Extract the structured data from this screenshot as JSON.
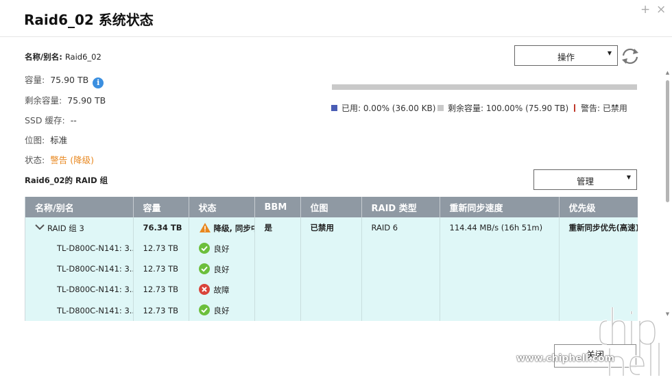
{
  "window": {
    "title": "Raid6_02  系统状态",
    "add_icon": "plus-icon",
    "close_icon": "close-icon"
  },
  "info": {
    "name_label": "名称/别名:",
    "name_value": "Raid6_02",
    "capacity_label": "容量:",
    "capacity_value": "75.90 TB",
    "free_label": "剩余容量:",
    "free_value": "75.90 TB",
    "ssd_cache_label": "SSD 缓存:",
    "ssd_cache_value": "--",
    "bitmap_label": "位图:",
    "bitmap_value": "标准",
    "status_label": "状态:",
    "status_value": "警告 (降级)"
  },
  "actions": {
    "operation_label": "操作",
    "manage_label": "管理"
  },
  "usage": {
    "used_fraction": 0.0,
    "legend_used": "已用: 0.00% (36.00 KB)",
    "legend_free": "剩余容量: 100.00% (75.90 TB)",
    "legend_warning": "警告: 已禁用",
    "color_used": "#4a5db5",
    "color_free": "#c9c9c9",
    "color_warning": "#c0392b"
  },
  "raid_group_title": "Raid6_02的 RAID 组",
  "table": {
    "headers": [
      "名称/别名",
      "容量",
      "状态",
      "BBM",
      "位图",
      "RAID 类型",
      "重新同步速度",
      "优先级"
    ],
    "group": {
      "name": "RAID 组 3",
      "capacity": "76.34 TB",
      "status": "降级, 同步中",
      "bbm": "是",
      "bitmap": "已禁用",
      "raid_type": "RAID 6",
      "resync_speed": "114.44 MB/s (16h 51m)",
      "priority": "重新同步优先(高速)"
    },
    "disks": [
      {
        "name": "TL-D800C-N141: 3...",
        "capacity": "12.73 TB",
        "status": "良好",
        "status_icon": "check-icon"
      },
      {
        "name": "TL-D800C-N141: 3...",
        "capacity": "12.73 TB",
        "status": "良好",
        "status_icon": "check-icon"
      },
      {
        "name": "TL-D800C-N141: 3...",
        "capacity": "12.73 TB",
        "status": "故障",
        "status_icon": "error-icon"
      },
      {
        "name": "TL-D800C-N141: 3...",
        "capacity": "12.73 TB",
        "status": "良好",
        "status_icon": "check-icon"
      }
    ]
  },
  "footer": {
    "close_label": "关闭"
  },
  "watermark": {
    "text": "www.chiphell.com",
    "logo": "chiphell"
  }
}
